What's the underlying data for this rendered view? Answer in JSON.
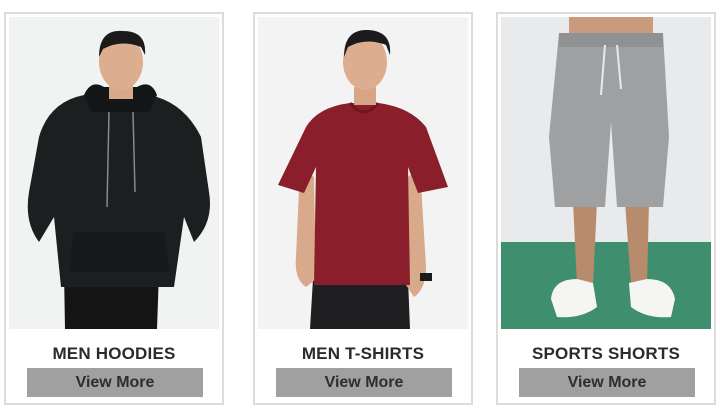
{
  "products": [
    {
      "title": "MEN HOODIES",
      "button_label": "View More",
      "image_icon": "man-in-black-hoodie"
    },
    {
      "title": "MEN T-SHIRTS",
      "button_label": "View More",
      "image_icon": "man-in-maroon-tshirt"
    },
    {
      "title": "SPORTS SHORTS",
      "button_label": "View More",
      "image_icon": "grey-sports-shorts-legs"
    }
  ],
  "colors": {
    "card_border": "#dcdcdc",
    "button_bg": "#a0a0a0",
    "button_text": "#2e2e2e",
    "title_text": "#2b2b2b"
  }
}
